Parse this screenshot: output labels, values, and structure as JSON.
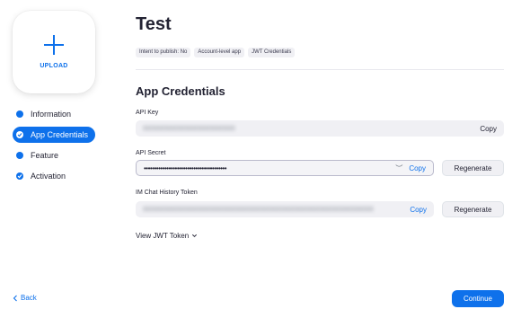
{
  "upload": {
    "label": "UPLOAD"
  },
  "steps": [
    {
      "label": "Information",
      "state": "completed"
    },
    {
      "label": "App Credentials",
      "state": "active"
    },
    {
      "label": "Feature",
      "state": "pending"
    },
    {
      "label": "Activation",
      "state": "completed"
    }
  ],
  "app": {
    "title": "Test",
    "tags": [
      "Intent to publish: No",
      "Account-level app",
      "JWT Credentials"
    ]
  },
  "section": {
    "title": "App Credentials"
  },
  "fields": {
    "api_key": {
      "label": "API Key",
      "value": "XXXXXXXXXXXXXXXXXXXXXX",
      "copy_label": "Copy"
    },
    "api_secret": {
      "label": "API Secret",
      "value": "••••••••••••••••••••••••••••••••••••••••",
      "copy_label": "Copy",
      "regenerate_label": "Regenerate"
    },
    "im_token": {
      "label": "IM Chat History Token",
      "value": "XXXXXXXXXXXXXXXXXXXXXXXXXXXXXXXXXXXXXXXXXXXXXXXXXXXXXXX",
      "copy_label": "Copy",
      "regenerate_label": "Regenerate"
    }
  },
  "view_jwt_label": "View JWT Token",
  "nav": {
    "back_label": "Back",
    "continue_label": "Continue"
  },
  "colors": {
    "accent": "#0e71eb",
    "field_bg": "#f0f0f4",
    "text": "#232333"
  }
}
